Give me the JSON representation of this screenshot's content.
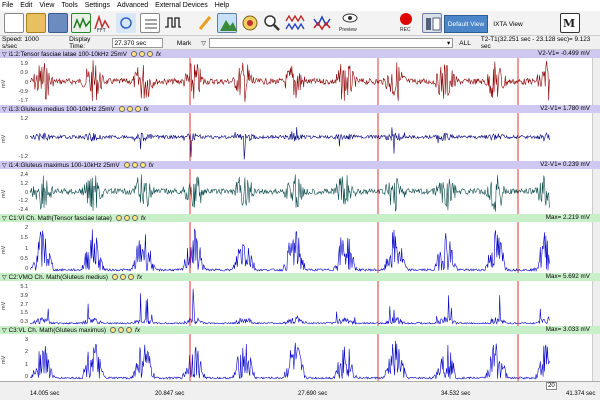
{
  "menu": [
    "File",
    "Edit",
    "View",
    "Tools",
    "Settings",
    "Advanced",
    "External Devices",
    "Help"
  ],
  "toolbar": {
    "preview_label": "Preview",
    "rec_label": "REC",
    "default_view": "Default View",
    "ixta_view": "IXTA View",
    "icons": [
      "new-file-icon",
      "open-folder-icon",
      "save-icon",
      "analysis-icon",
      "fft-icon",
      "xy-icon",
      "marks-icon",
      "wave-icon",
      "pencil-icon",
      "mountain-icon",
      "target-icon",
      "zoom-icon",
      "waveform-icon",
      "heart-icon",
      "eye-icon",
      "record-icon",
      "sidebar-icon",
      "logo-icon"
    ]
  },
  "controls": {
    "speed": "Speed: 1000 s/sec",
    "display_time_label": "Display Time:",
    "display_time_value": "27.370 sec",
    "mark_label": "Mark",
    "all_label": "ALL",
    "t2t1": "T2-T1(32.251 sec - 23.128 sec)= 9.123 sec"
  },
  "panels": [
    {
      "name": "i1:2:Tensor fasciae latae  100-10kHz 25mV",
      "value": "V2-V1= -0.499 mV",
      "color": "#8b0000",
      "head_bg": "#cfc8f0",
      "ticks": [
        "1.9",
        "0.9",
        "0",
        "-0.9",
        "-1.7"
      ],
      "unit": "mV",
      "kind": "raw"
    },
    {
      "name": "i1:3:Gluteus medius  100-10kHz 25mV",
      "value": "V2-V1= 1.780 mV",
      "color": "#000080",
      "head_bg": "#cfc8f0",
      "ticks": [
        "1.2",
        "0",
        "-1.2"
      ],
      "unit": "mV",
      "kind": "sparse"
    },
    {
      "name": "i1:4:Gluteus maximus  100-10kHz 25mV",
      "value": "V2-V1= 0.239 mV",
      "color": "#0d4d4d",
      "head_bg": "#cfc8f0",
      "ticks": [
        "2.4",
        "1.2",
        "0",
        "-1.2",
        "-2.4"
      ],
      "unit": "mV",
      "kind": "raw"
    },
    {
      "name": "C1:VI Ch. Math(Tensor fasciae latae)",
      "value": "Max= 2.219 mV",
      "color": "#0000c8",
      "head_bg": "#c8f0c8",
      "ticks": [
        "2",
        "1.5",
        "1",
        "0.5",
        "0"
      ],
      "unit": "mV",
      "kind": "rect"
    },
    {
      "name": "C2:VMO Ch. Math(Gluteus medius)",
      "value": "Max= 5.692 mV",
      "color": "#0000c8",
      "head_bg": "#c8f0c8",
      "ticks": [
        "5.1",
        "3.9",
        "2.7",
        "1.5",
        "0.3"
      ],
      "unit": "mV",
      "kind": "rectsparse"
    },
    {
      "name": "C3:VL Ch. Math(Gluteus maximus)",
      "value": "Max= 3.033 mV",
      "color": "#0000c8",
      "head_bg": "#c8f0c8",
      "ticks": [
        "3",
        "2",
        "1",
        "0"
      ],
      "unit": "mV",
      "kind": "rect"
    }
  ],
  "time_axis": {
    "labels": [
      "14.005 sec",
      "20.847 sec",
      "27.690 sec",
      "34.532 sec",
      "41.374 sec"
    ],
    "marker": "20"
  },
  "colors": {
    "cursor_line": "#e00000"
  }
}
